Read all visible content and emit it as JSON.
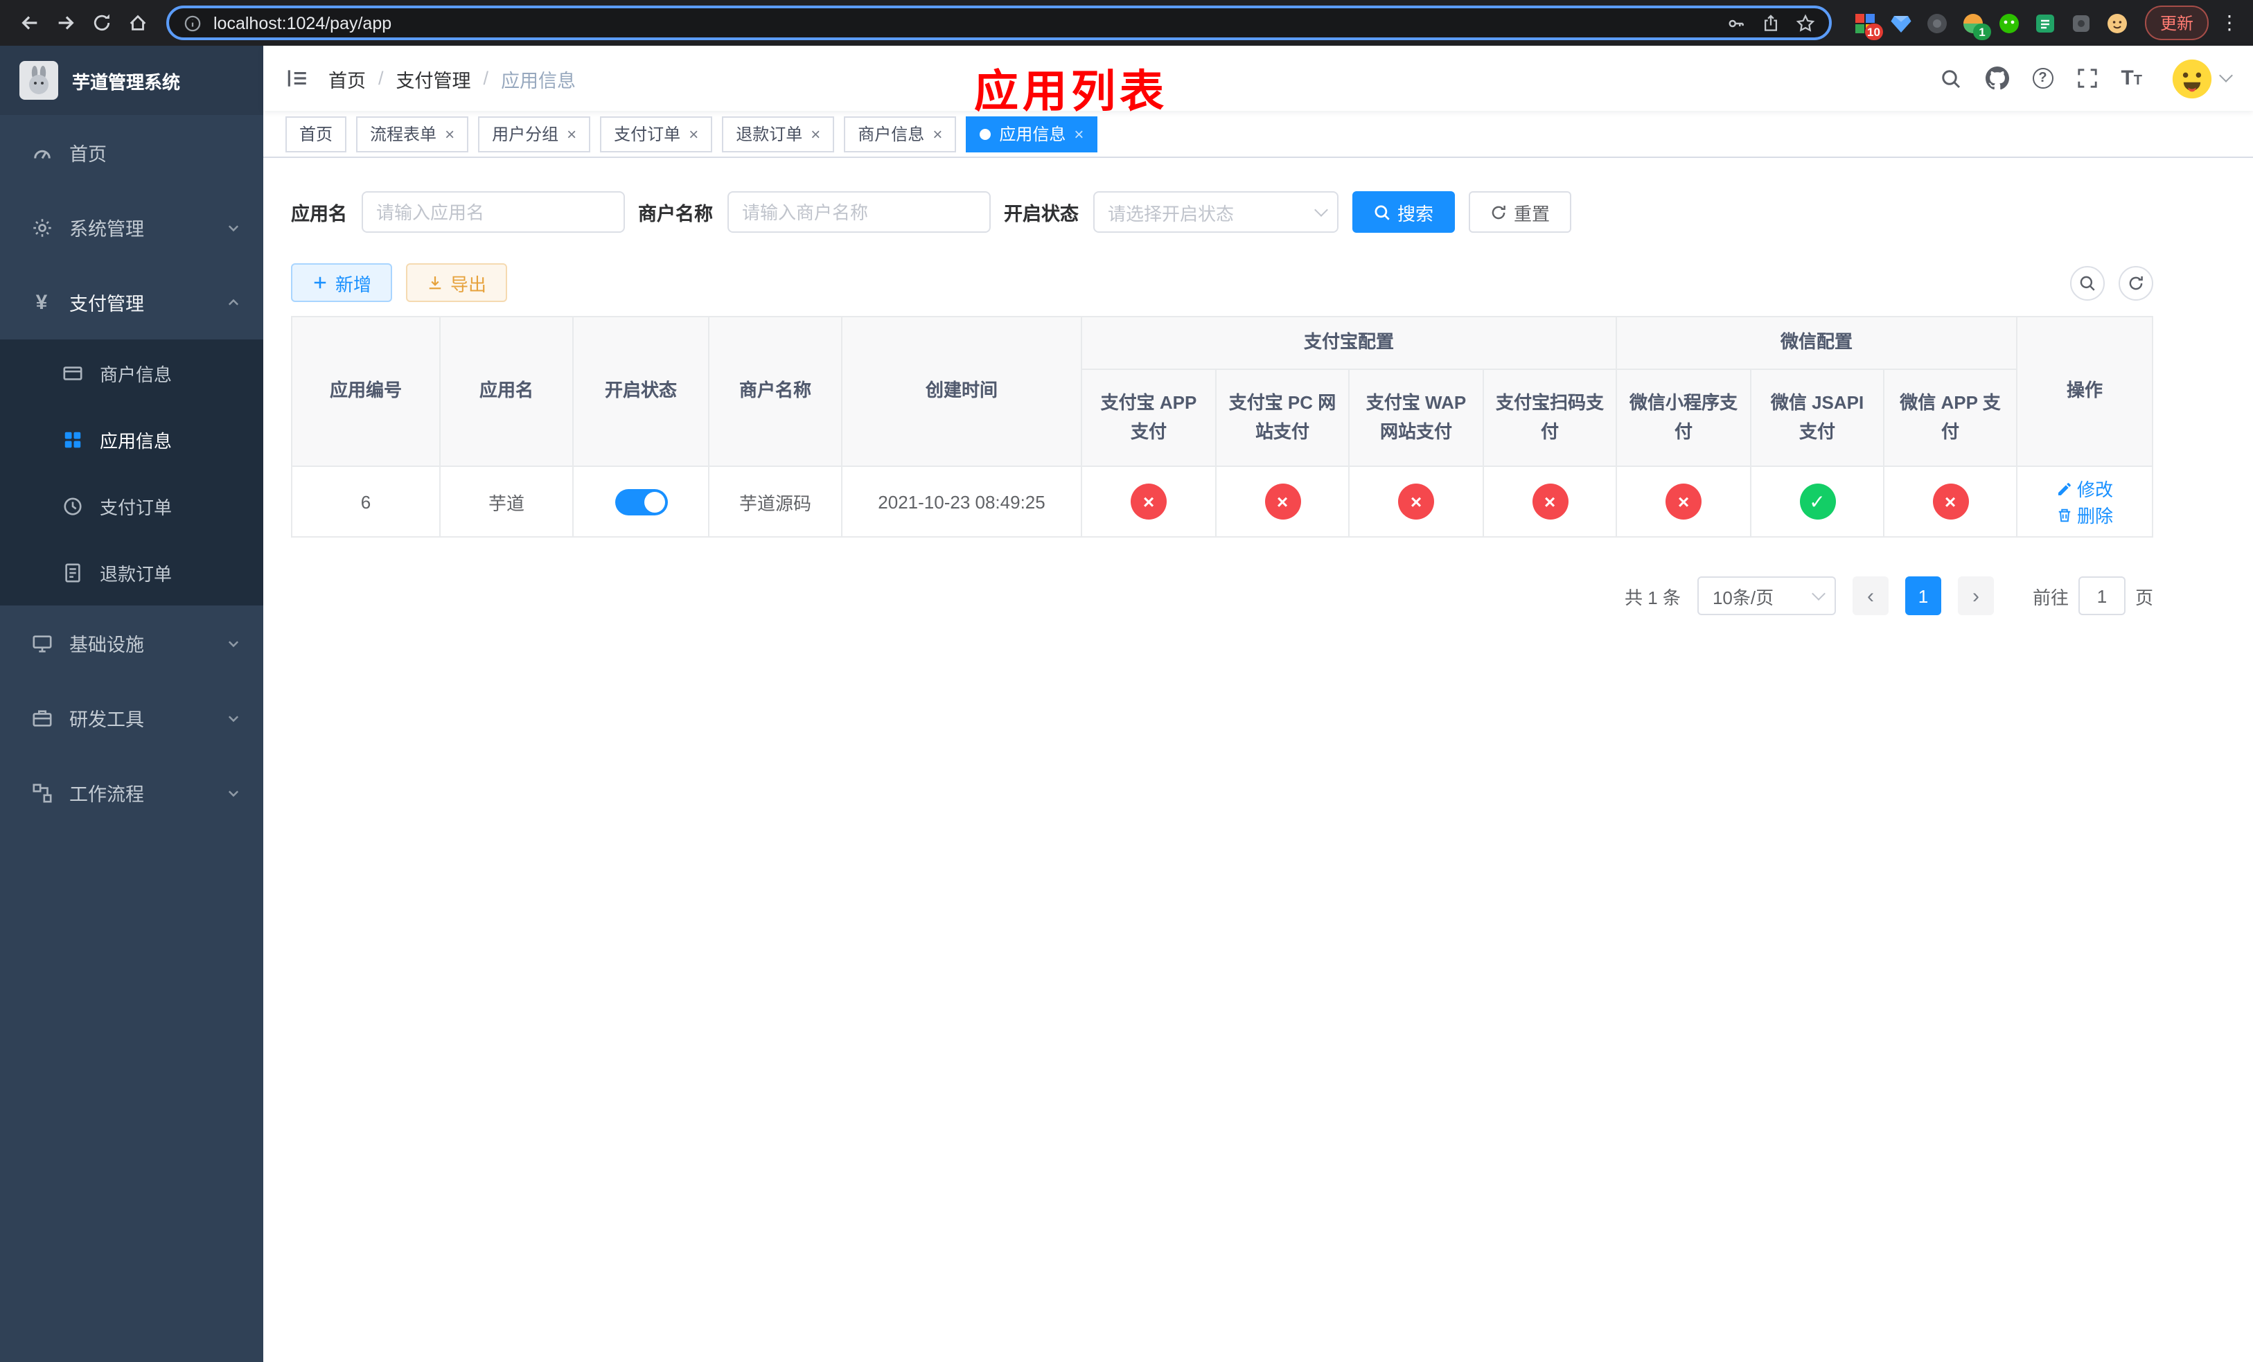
{
  "theme": {
    "accent": "#1890ff",
    "danger": "#f5484d",
    "success": "#13ce66",
    "annotation": "#ff0000"
  },
  "browser": {
    "url": "localhost:1024/pay/app",
    "update_label": "更新",
    "extension_badges": {
      "first": "10",
      "second": "1"
    }
  },
  "sidebar": {
    "title": "芋道管理系统",
    "items": [
      {
        "label": "首页"
      },
      {
        "label": "系统管理"
      },
      {
        "label": "支付管理",
        "children": [
          {
            "label": "商户信息"
          },
          {
            "label": "应用信息",
            "active": true
          },
          {
            "label": "支付订单"
          },
          {
            "label": "退款订单"
          }
        ]
      },
      {
        "label": "基础设施"
      },
      {
        "label": "研发工具"
      },
      {
        "label": "工作流程"
      }
    ]
  },
  "navbar": {
    "breadcrumb": [
      "首页",
      "支付管理",
      "应用信息"
    ],
    "annotation": "应用列表"
  },
  "tabs": [
    {
      "label": "首页",
      "closable": false,
      "active": false
    },
    {
      "label": "流程表单",
      "closable": true,
      "active": false
    },
    {
      "label": "用户分组",
      "closable": true,
      "active": false
    },
    {
      "label": "支付订单",
      "closable": true,
      "active": false
    },
    {
      "label": "退款订单",
      "closable": true,
      "active": false
    },
    {
      "label": "商户信息",
      "closable": true,
      "active": false
    },
    {
      "label": "应用信息",
      "closable": true,
      "active": true
    }
  ],
  "filters": {
    "app_name_label": "应用名",
    "app_name_placeholder": "请输入应用名",
    "merchant_label": "商户名称",
    "merchant_placeholder": "请输入商户名称",
    "status_label": "开启状态",
    "status_placeholder": "请选择开启状态",
    "search_label": "搜索",
    "reset_label": "重置"
  },
  "toolbar": {
    "add_label": "新增",
    "export_label": "导出"
  },
  "table": {
    "group_headers": {
      "alipay": "支付宝配置",
      "wechat": "微信配置"
    },
    "columns": {
      "app_id": "应用编号",
      "app_name": "应用名",
      "status": "开启状态",
      "merchant": "商户名称",
      "created": "创建时间",
      "alipay_app": "支付宝 APP 支付",
      "alipay_pc": "支付宝 PC 网站支付",
      "alipay_wap": "支付宝 WAP 网站支付",
      "alipay_qr": "支付宝扫码支付",
      "wx_lite": "微信小程序支付",
      "wx_jsapi": "微信 JSAPI 支付",
      "wx_app": "微信 APP 支付",
      "actions": "操作"
    },
    "rows": [
      {
        "app_id": "6",
        "app_name": "芋道",
        "enabled": true,
        "merchant": "芋道源码",
        "created": "2021-10-23 08:49:25",
        "configs": {
          "alipay_app": false,
          "alipay_pc": false,
          "alipay_wap": false,
          "alipay_qr": false,
          "wx_lite": false,
          "wx_jsapi": true,
          "wx_app": false
        },
        "edit_label": "修改",
        "delete_label": "删除"
      }
    ]
  },
  "pagination": {
    "total": "共 1 条",
    "page_size": "10条/页",
    "current": "1",
    "goto_label": "前往",
    "goto_value": "1",
    "page_label": "页"
  }
}
